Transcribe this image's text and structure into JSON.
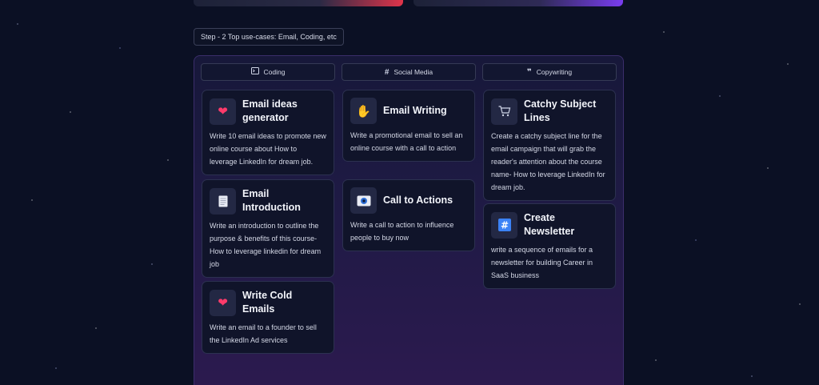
{
  "step": {
    "label": "Step - 2 Top use-cases: Email, Coding, etc"
  },
  "columns": [
    {
      "label": "Coding",
      "icon": "terminal-icon"
    },
    {
      "label": "Social Media",
      "icon": "hash-icon"
    },
    {
      "label": "Copywriting",
      "icon": "quote-icon"
    }
  ],
  "cards": {
    "email_ideas": {
      "title": "Email ideas generator",
      "desc": "Write 10 email ideas to promote new online course about How to leverage LinkedIn for dream job.",
      "icon": "heart-icon"
    },
    "email_intro": {
      "title": "Email Introduction",
      "desc": "Write an introduction to outline the purpose & benefits of this course- How to leverage linkedin for dream job",
      "icon": "document-icon"
    },
    "cold_emails": {
      "title": "Write Cold Emails",
      "desc": "Write an email to a founder to sell the LinkedIn Ad services",
      "icon": "heart-icon"
    },
    "email_writing": {
      "title": "Email Writing",
      "desc": "Write a promotional email to sell an online course with a call to action",
      "icon": "hand-icon"
    },
    "call_to_actions": {
      "title": "Call to Actions",
      "desc": "Write a call to action to influence people to buy now",
      "icon": "eye-icon"
    },
    "subject_lines": {
      "title": "Catchy Subject Lines",
      "desc": "Create a catchy subject line for the email campaign that will grab the reader's attention about the course name- How to leverage LinkedIn for dream job.",
      "icon": "cart-icon"
    },
    "newsletter": {
      "title": "Create Newsletter",
      "desc": "write a sequence of emails for a newsletter for building Career in SaaS business",
      "icon": "hash-box-icon"
    }
  },
  "colors": {
    "background": "#0b1024",
    "panel_border": "#3b2d6b",
    "card_bg": "#10142a",
    "accent_red": "#e0344a",
    "accent_purple": "#7a3df0"
  }
}
